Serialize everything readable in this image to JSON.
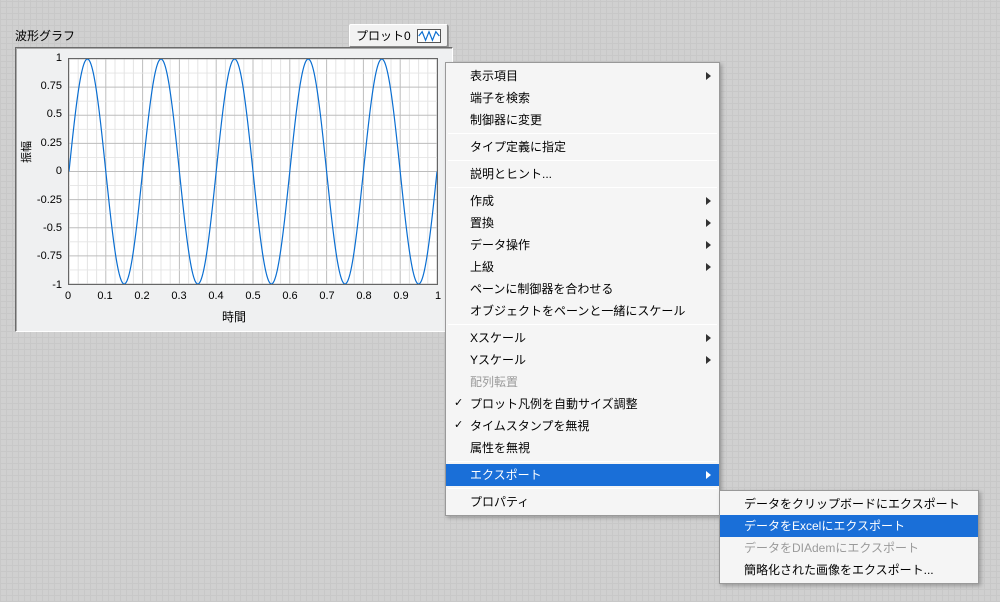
{
  "chart": {
    "title": "波形グラフ",
    "legend_label": "プロット0",
    "ylabel": "振幅",
    "xlabel": "時間",
    "yticks": [
      "1",
      "0.75",
      "0.5",
      "0.25",
      "0",
      "-0.25",
      "-0.5",
      "-0.75",
      "-1"
    ],
    "xticks": [
      "0",
      "0.1",
      "0.2",
      "0.3",
      "0.4",
      "0.5",
      "0.6",
      "0.7",
      "0.8",
      "0.9",
      "1"
    ],
    "line_color": "#0a6ed1"
  },
  "chart_data": {
    "type": "line",
    "title": "波形グラフ",
    "xlabel": "時間",
    "ylabel": "振幅",
    "xlim": [
      0,
      1
    ],
    "ylim": [
      -1,
      1
    ],
    "series": [
      {
        "name": "プロット0",
        "function": "sin(2*pi*5*x)",
        "x_range": [
          0,
          1
        ],
        "samples": 500
      }
    ]
  },
  "menu1": {
    "items": [
      {
        "label": "表示項目",
        "sub": true
      },
      {
        "label": "端子を検索"
      },
      {
        "label": "制御器に変更"
      },
      {
        "sep": true
      },
      {
        "label": "タイプ定義に指定"
      },
      {
        "sep": true
      },
      {
        "label": "説明とヒント..."
      },
      {
        "sep": true
      },
      {
        "label": "作成",
        "sub": true
      },
      {
        "label": "置換",
        "sub": true
      },
      {
        "label": "データ操作",
        "sub": true
      },
      {
        "label": "上級",
        "sub": true
      },
      {
        "label": "ペーンに制御器を合わせる"
      },
      {
        "label": "オブジェクトをペーンと一緒にスケール"
      },
      {
        "sep": true
      },
      {
        "label": "Xスケール",
        "sub": true
      },
      {
        "label": "Yスケール",
        "sub": true
      },
      {
        "label": "配列転置",
        "disabled": true
      },
      {
        "label": "プロット凡例を自動サイズ調整",
        "check": true
      },
      {
        "label": "タイムスタンプを無視",
        "check": true
      },
      {
        "label": "属性を無視"
      },
      {
        "sep": true
      },
      {
        "label": "エクスポート",
        "sub": true,
        "highlight": true
      },
      {
        "sep": true
      },
      {
        "label": "プロパティ"
      }
    ]
  },
  "menu2": {
    "items": [
      {
        "label": "データをクリップボードにエクスポート"
      },
      {
        "label": "データをExcelにエクスポート",
        "highlight": true
      },
      {
        "label": "データをDIAdemにエクスポート",
        "disabled": true
      },
      {
        "label": "簡略化された画像をエクスポート..."
      }
    ]
  }
}
